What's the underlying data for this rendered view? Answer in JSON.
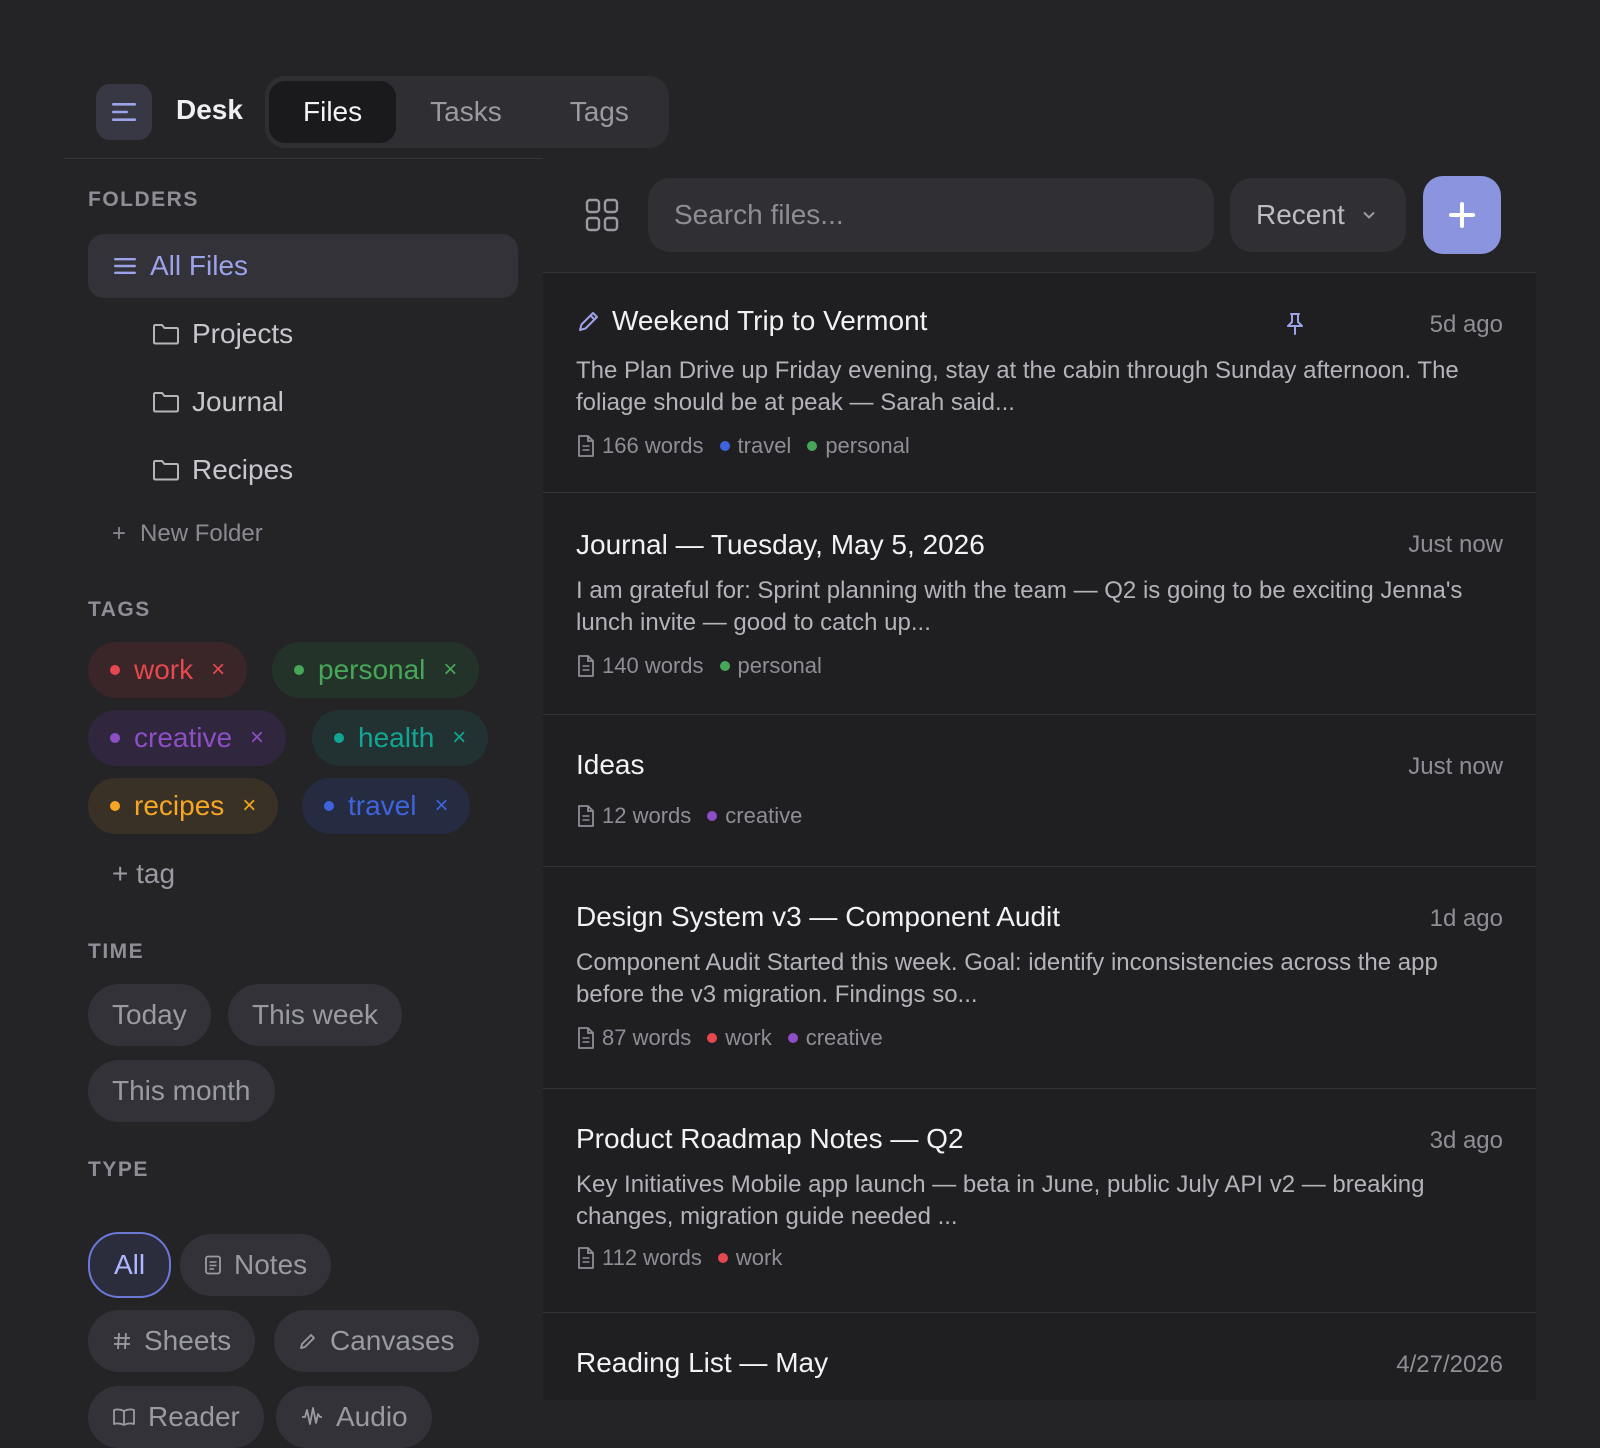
{
  "header": {
    "app_title": "Desk",
    "tabs": [
      {
        "label": "Files",
        "active": true
      },
      {
        "label": "Tasks",
        "active": false
      },
      {
        "label": "Tags",
        "active": false
      }
    ]
  },
  "sidebar": {
    "folders_heading": "FOLDERS",
    "all_files_label": "All Files",
    "folders": [
      {
        "label": "Projects"
      },
      {
        "label": "Journal"
      },
      {
        "label": "Recipes"
      }
    ],
    "new_folder_label": "New Folder",
    "tags_heading": "TAGS",
    "tags": [
      {
        "label": "work",
        "color": "#e5484d"
      },
      {
        "label": "personal",
        "color": "#46a758"
      },
      {
        "label": "creative",
        "color": "#8e4ec6"
      },
      {
        "label": "health",
        "color": "#12a594"
      },
      {
        "label": "recipes",
        "color": "#f5a623"
      },
      {
        "label": "travel",
        "color": "#3e63dd"
      }
    ],
    "add_tag_label": "+ tag",
    "time_heading": "TIME",
    "time_filters": [
      {
        "label": "Today"
      },
      {
        "label": "This week"
      },
      {
        "label": "This month"
      }
    ],
    "type_heading": "TYPE",
    "type_filters": [
      {
        "label": "All",
        "active": true,
        "icon": "none"
      },
      {
        "label": "Notes",
        "icon": "note-icon"
      },
      {
        "label": "Sheets",
        "icon": "hash-icon"
      },
      {
        "label": "Canvases",
        "icon": "pencil-icon"
      },
      {
        "label": "Reader",
        "icon": "book-icon"
      },
      {
        "label": "Audio",
        "icon": "waveform-icon"
      }
    ]
  },
  "toolbar": {
    "search_placeholder": "Search files...",
    "sort_label": "Recent"
  },
  "files": [
    {
      "title": "Weekend Trip to Vermont",
      "time": "5d ago",
      "pinned": true,
      "type_icon": "pencil-icon",
      "preview": "The Plan Drive up Friday evening, stay at the cabin through Sunday afternoon. The foliage should be at peak — Sarah said...",
      "words": "166 words",
      "tags": [
        {
          "label": "travel",
          "color": "#3e63dd"
        },
        {
          "label": "personal",
          "color": "#46a758"
        }
      ]
    },
    {
      "title": "Journal — Tuesday, May 5, 2026",
      "time": "Just now",
      "preview": "I am grateful for: Sprint planning with the team — Q2 is going to be exciting Jenna's lunch invite — good to catch up...",
      "words": "140 words",
      "tags": [
        {
          "label": "personal",
          "color": "#46a758"
        }
      ]
    },
    {
      "title": "Ideas",
      "time": "Just now",
      "preview": "",
      "words": "12 words",
      "tags": [
        {
          "label": "creative",
          "color": "#8e4ec6"
        }
      ]
    },
    {
      "title": "Design System v3 — Component Audit",
      "time": "1d ago",
      "preview": "Component Audit Started this week. Goal: identify inconsistencies across the app before the v3 migration. Findings so...",
      "words": "87 words",
      "tags": [
        {
          "label": "work",
          "color": "#e5484d"
        },
        {
          "label": "creative",
          "color": "#8e4ec6"
        }
      ]
    },
    {
      "title": "Product Roadmap Notes — Q2",
      "time": "3d ago",
      "preview": "Key Initiatives Mobile app launch — beta in June, public July API v2 — breaking changes, migration guide needed ...",
      "words": "112 words",
      "tags": [
        {
          "label": "work",
          "color": "#e5484d"
        }
      ]
    },
    {
      "title": "Reading List — May",
      "time": "4/27/2026",
      "preview": "",
      "words": "",
      "tags": []
    }
  ]
}
